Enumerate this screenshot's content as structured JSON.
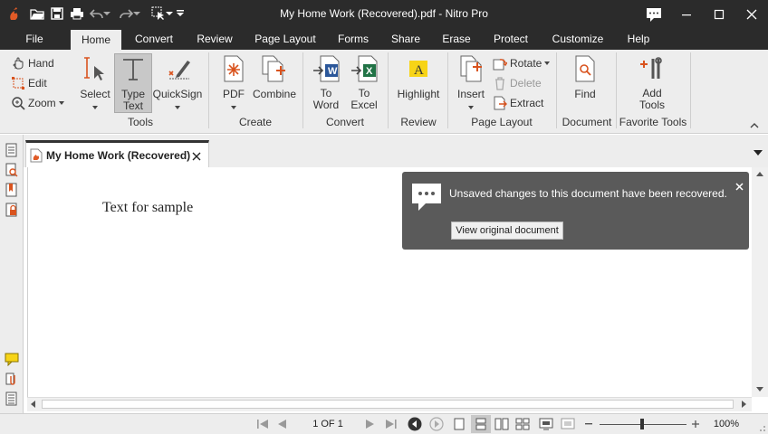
{
  "window": {
    "title": "My Home Work (Recovered).pdf - Nitro Pro"
  },
  "menu": {
    "file": "File",
    "tabs": [
      "Home",
      "Convert",
      "Review",
      "Page Layout",
      "Forms",
      "Share",
      "Erase",
      "Protect",
      "Customize",
      "Help"
    ]
  },
  "ribbon": {
    "hand": "Hand",
    "edit": "Edit",
    "zoom": "Zoom",
    "select": "Select",
    "type_text": [
      "Type",
      "Text"
    ],
    "quicksign": "QuickSign",
    "tools_group": "Tools",
    "pdf": "PDF",
    "combine": "Combine",
    "create_group": "Create",
    "to_word": [
      "To",
      "Word"
    ],
    "to_excel": [
      "To",
      "Excel"
    ],
    "convert_group": "Convert",
    "highlight": "Highlight",
    "review_group": "Review",
    "insert": "Insert",
    "rotate": "Rotate",
    "delete": "Delete",
    "extract": "Extract",
    "page_layout_group": "Page Layout",
    "find": "Find",
    "document_group": "Document",
    "add_tools": [
      "Add",
      "Tools"
    ],
    "favorite_tools_group": "Favorite Tools"
  },
  "document": {
    "tab_title": "My Home Work (Recovered)",
    "body_text": "Text for sample"
  },
  "notification": {
    "message": "Unsaved changes to this document have been recovered.",
    "button": "View original document"
  },
  "status": {
    "page": "1 OF 1",
    "zoom": "100%",
    "zoom_level": 0.5
  },
  "colors": {
    "accent": "#d9531e",
    "titlebar": "#2b2b2b",
    "ribbon": "#ededed"
  }
}
